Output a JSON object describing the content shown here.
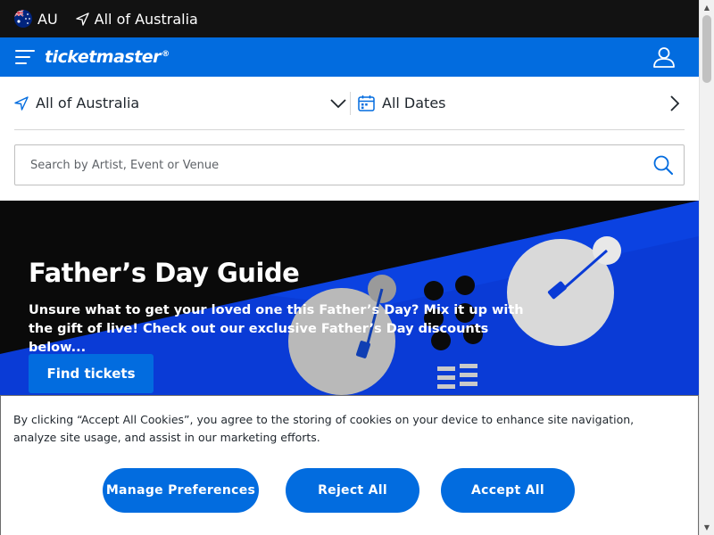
{
  "topbar": {
    "country_code": "AU",
    "location": "All of Australia"
  },
  "brandbar": {
    "logo": "ticketmaster",
    "logo_mark": "®"
  },
  "filters": {
    "location": "All of Australia",
    "dates": "All Dates"
  },
  "search": {
    "placeholder": "Search by Artist, Event or Venue"
  },
  "hero": {
    "title": "Father’s Day Guide",
    "description": "Unsure what to get your loved one this Father’s Day? Mix it up with the gift of live! Check out our exclusive Father’s Day discounts below...",
    "cta": "Find tickets"
  },
  "cookie_banner": {
    "text": "By clicking “Accept All Cookies”, you agree to the storing of cookies on your device to enhance site navigation, analyze site usage, and assist in our marketing efforts.",
    "manage_label": "Manage Preferences",
    "reject_label": "Reject All",
    "accept_label": "Accept All"
  },
  "colors": {
    "brand_blue": "#026cdf",
    "topbar_bg": "#121212",
    "hero_bg": "#0a0a0a"
  },
  "icons": [
    "australia-flag-icon",
    "navigation-arrow-icon",
    "menu-icon",
    "user-icon",
    "chevron-down-icon",
    "calendar-icon",
    "chevron-right-icon",
    "search-icon"
  ]
}
